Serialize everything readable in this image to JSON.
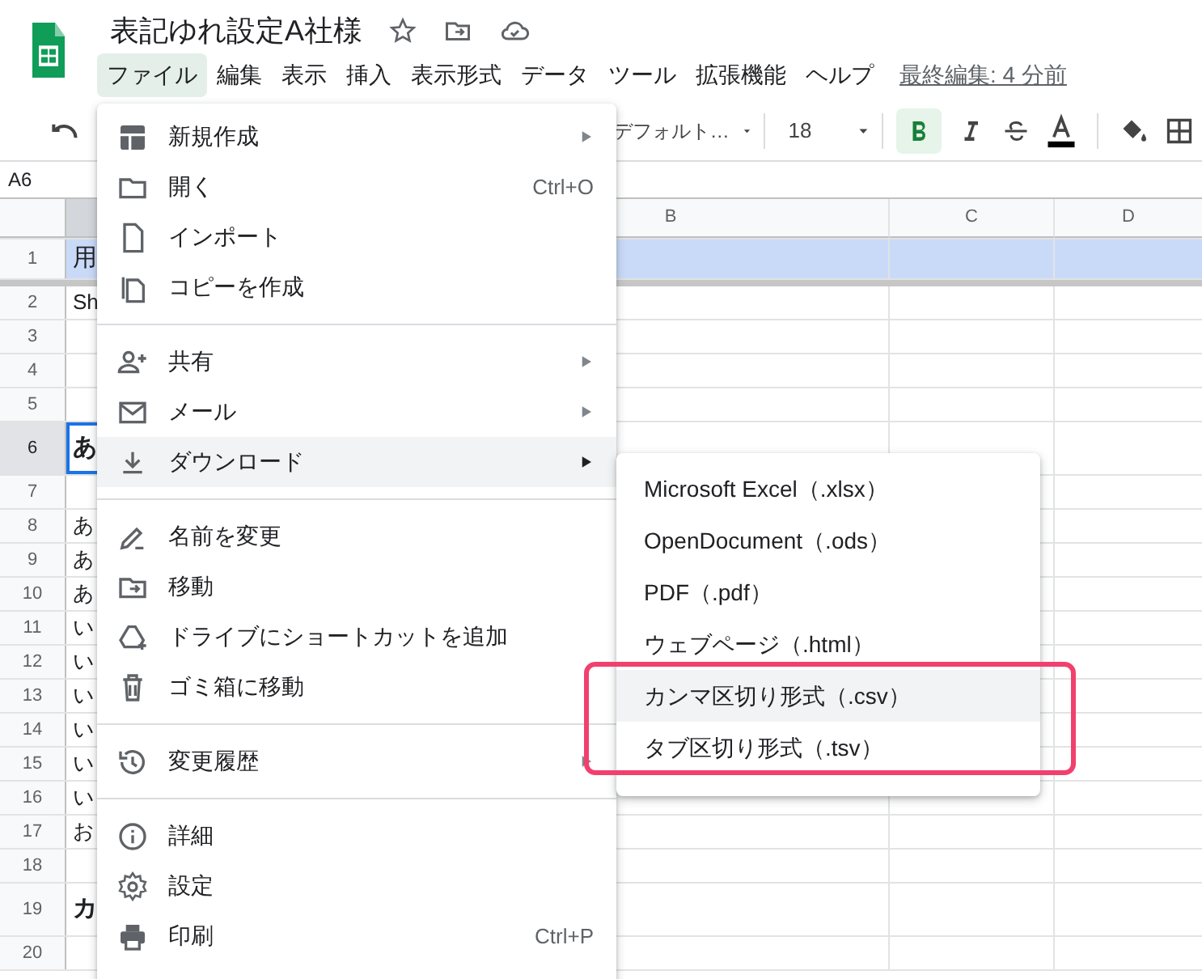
{
  "document": {
    "title": "表記ゆれ設定A社様"
  },
  "menubar": [
    {
      "label": "ファイル",
      "selected": true
    },
    {
      "label": "編集",
      "selected": false
    },
    {
      "label": "表示",
      "selected": false
    },
    {
      "label": "挿入",
      "selected": false
    },
    {
      "label": "表示形式",
      "selected": false
    },
    {
      "label": "データ",
      "selected": false
    },
    {
      "label": "ツール",
      "selected": false
    },
    {
      "label": "拡張機能",
      "selected": false
    },
    {
      "label": "ヘルプ",
      "selected": false
    }
  ],
  "last_edit": "最終編集: 4 分前",
  "toolbar": {
    "font": "デフォルト…",
    "font_size": "18",
    "bold": true
  },
  "name_box": "A6",
  "sheet": {
    "columns": [
      "B",
      "C",
      "D"
    ],
    "rows": [
      {
        "number": "1",
        "kind": "header",
        "selected": false,
        "cell": "用"
      },
      {
        "number": "2",
        "kind": "text",
        "selected": false,
        "cell": "Sh"
      },
      {
        "number": "3",
        "kind": "text",
        "selected": false
      },
      {
        "number": "4",
        "kind": "text",
        "selected": false
      },
      {
        "number": "5",
        "kind": "text",
        "selected": false
      },
      {
        "number": "6",
        "kind": "heading",
        "selected": true,
        "cell": "あ"
      },
      {
        "number": "7",
        "kind": "text",
        "selected": false
      },
      {
        "number": "8",
        "kind": "text",
        "selected": false,
        "cell": "あ"
      },
      {
        "number": "9",
        "kind": "text",
        "selected": false,
        "cell": "あ"
      },
      {
        "number": "10",
        "kind": "text",
        "selected": false,
        "cell": "あ"
      },
      {
        "number": "11",
        "kind": "text",
        "selected": false,
        "cell": "い"
      },
      {
        "number": "12",
        "kind": "text",
        "selected": false,
        "cell": "い"
      },
      {
        "number": "13",
        "kind": "text",
        "selected": false,
        "cell": "い"
      },
      {
        "number": "14",
        "kind": "text",
        "selected": false,
        "cell": "い"
      },
      {
        "number": "15",
        "kind": "text",
        "selected": false,
        "cell": "い"
      },
      {
        "number": "16",
        "kind": "text",
        "selected": false,
        "cell": "い"
      },
      {
        "number": "17",
        "kind": "text",
        "selected": false,
        "cell": "お"
      },
      {
        "number": "18",
        "kind": "text",
        "selected": false
      },
      {
        "number": "19",
        "kind": "heading",
        "selected": false,
        "cell": "カ"
      },
      {
        "number": "20",
        "kind": "text",
        "selected": false
      }
    ]
  },
  "file_menu": {
    "items": [
      {
        "kind": "item",
        "label": "新規作成",
        "submenu": true,
        "highlighted": false
      },
      {
        "kind": "item",
        "label": "開く",
        "shortcut": "Ctrl+O",
        "submenu": false,
        "highlighted": false
      },
      {
        "kind": "item",
        "label": "インポート",
        "submenu": false,
        "highlighted": false
      },
      {
        "kind": "item",
        "label": "コピーを作成",
        "submenu": false,
        "highlighted": false
      },
      {
        "kind": "separator"
      },
      {
        "kind": "item",
        "label": "共有",
        "submenu": true,
        "highlighted": false
      },
      {
        "kind": "item",
        "label": "メール",
        "submenu": true,
        "highlighted": false
      },
      {
        "kind": "item",
        "label": "ダウンロード",
        "submenu": true,
        "highlighted": true
      },
      {
        "kind": "separator"
      },
      {
        "kind": "item",
        "label": "名前を変更",
        "submenu": false,
        "highlighted": false
      },
      {
        "kind": "item",
        "label": "移動",
        "submenu": false,
        "highlighted": false
      },
      {
        "kind": "item",
        "label": "ドライブにショートカットを追加",
        "submenu": false,
        "highlighted": false
      },
      {
        "kind": "item",
        "label": "ゴミ箱に移動",
        "submenu": false,
        "highlighted": false
      },
      {
        "kind": "separator"
      },
      {
        "kind": "item",
        "label": "変更履歴",
        "submenu": true,
        "highlighted": false
      },
      {
        "kind": "separator"
      },
      {
        "kind": "item",
        "label": "詳細",
        "submenu": false,
        "highlighted": false
      },
      {
        "kind": "item",
        "label": "設定",
        "submenu": false,
        "highlighted": false
      },
      {
        "kind": "item",
        "label": "印刷",
        "shortcut": "Ctrl+P",
        "submenu": false,
        "highlighted": false
      }
    ]
  },
  "download_menu": {
    "items": [
      {
        "label": "Microsoft Excel（.xlsx）",
        "highlighted": false
      },
      {
        "label": "OpenDocument（.ods）",
        "highlighted": false
      },
      {
        "label": "PDF（.pdf）",
        "highlighted": false
      },
      {
        "label": "ウェブページ（.html）",
        "highlighted": false
      },
      {
        "label": "カンマ区切り形式（.csv）",
        "highlighted": true
      },
      {
        "label": "タブ区切り形式（.tsv）",
        "highlighted": false
      }
    ]
  }
}
